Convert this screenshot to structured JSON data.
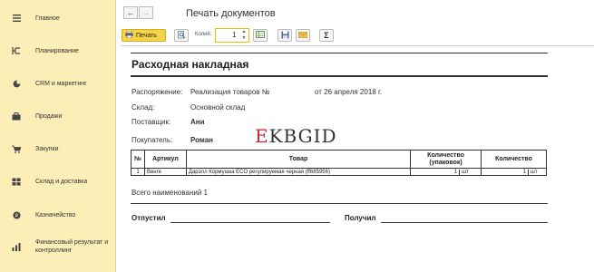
{
  "sidebar": {
    "items": [
      {
        "label": "Главное",
        "icon": "menu-icon"
      },
      {
        "label": "Планирование",
        "icon": "planning-icon"
      },
      {
        "label": "CRM и маркетинг",
        "icon": "pie-chart-icon"
      },
      {
        "label": "Продажи",
        "icon": "briefcase-icon"
      },
      {
        "label": "Закупки",
        "icon": "cart-icon"
      },
      {
        "label": "Склад и доставка",
        "icon": "warehouse-icon"
      },
      {
        "label": "Казначейство",
        "icon": "coin-icon"
      },
      {
        "label": "Финансовый результат и контроллинг",
        "icon": "bar-chart-icon"
      }
    ]
  },
  "topbar": {
    "back": "←",
    "forward": "→",
    "title": "Печать документов"
  },
  "toolbar": {
    "print_label": "Печать",
    "copies_label": "Копий:",
    "copies_value": "1",
    "sum_label": "Σ"
  },
  "document": {
    "title": "Расходная накладная",
    "order_label": "Распоряжение:",
    "order_value": "Реализация товаров №",
    "order_date": "от 26 апреля 2018 г.",
    "warehouse_label": "Склад:",
    "warehouse_value": "Основной склад",
    "supplier_label": "Поставщик:",
    "supplier_value": "Ани",
    "buyer_label": "Покупатель:",
    "buyer_value": "Роман",
    "watermark_first": "E",
    "watermark_rest": "KBGID",
    "table": {
      "headers": {
        "num": "№",
        "article": "Артикул",
        "product": "Товар",
        "qty_pack": "Количество (упаковок)",
        "qty": "Количество"
      },
      "rows": [
        {
          "num": "1",
          "article": "Венге",
          "product": "Дарэлл Кормушка ECO регулируемая черная (ff685956)",
          "qty_pack": "1",
          "qty_pack_unit": "шт",
          "qty": "1",
          "qty_unit": "шт"
        }
      ]
    },
    "summary": "Всего наименований 1",
    "released_label": "Отпустил",
    "received_label": "Получил"
  }
}
